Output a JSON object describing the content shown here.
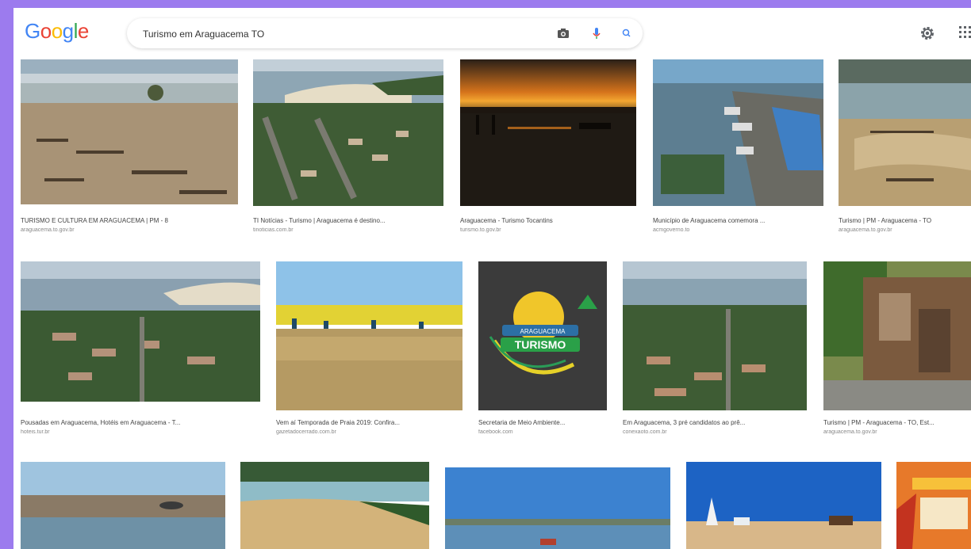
{
  "logo": {
    "letters": [
      "G",
      "o",
      "o",
      "g",
      "l",
      "e"
    ],
    "colors": [
      "#4285f4",
      "#ea4335",
      "#fbbc05",
      "#4285f4",
      "#34a853",
      "#ea4335"
    ]
  },
  "search": {
    "query": "Turismo em Araguacema TO"
  },
  "icons": {
    "camera": "camera-icon",
    "mic": "mic-icon",
    "search": "search-icon",
    "settings": "gear-icon",
    "apps": "apps-grid-icon"
  },
  "results": [
    {
      "caption": "TURISMO E CULTURA EM ARAGUACEMA | PM - 8",
      "source": "araguacema.to.gov.br"
    },
    {
      "caption": "TI Notícias - Turismo | Araguacema é destino...",
      "source": "tinoticias.com.br"
    },
    {
      "caption": "Araguacema - Turismo Tocantins",
      "source": "turismo.to.gov.br"
    },
    {
      "caption": "Município de Araguacema comemora ...",
      "source": "acmgoverno.to"
    },
    {
      "caption": "Turismo | PM - Araguacema - TO",
      "source": "araguacema.to.gov.br"
    },
    {
      "caption": "Pousadas em Araguacema, Hotéis em Araguacema - T...",
      "source": "hoteis.tur.br"
    },
    {
      "caption": "Vem aí Temporada de Praia 2019: Confira...",
      "source": "gazetadocerrado.com.br"
    },
    {
      "caption": "Secretaria de Meio Ambiente...",
      "source": "facebook.com"
    },
    {
      "caption": "Em Araguacema, 3 pré candidatos ao prê...",
      "source": "conexaoto.com.br"
    },
    {
      "caption": "Turismo | PM - Araguacema - TO, Est...",
      "source": "araguacema.to.gov.br"
    }
  ],
  "thumb_badge": {
    "line1": "ARAGUACEMA",
    "line2": "TURISMO"
  }
}
